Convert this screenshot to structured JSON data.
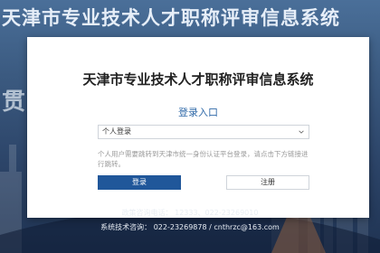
{
  "background": {
    "title": "天津市专业技术人才职称评审信息系统",
    "art_text": "贯"
  },
  "card": {
    "title": "天津市专业技术人才职称评审信息系统",
    "login_heading": "登录入口",
    "login_type": {
      "selected": "个人登录",
      "icon": "chevron-down-icon"
    },
    "notice": "个人用户需要跳转到天津市统一身份认证平台登录，请点击下方链接进行跳转。",
    "buttons": {
      "login": "登录",
      "register": "注册"
    }
  },
  "footer": {
    "policy_phone": "政策咨询电话： 12333、022-23269010",
    "tech_support": "系统技术咨询： 022-23269878  /  cnthrzc@163.com"
  },
  "colors": {
    "primary": "#20579a",
    "heading_blue": "#2f69a8",
    "background_dark": "#2a4366"
  }
}
